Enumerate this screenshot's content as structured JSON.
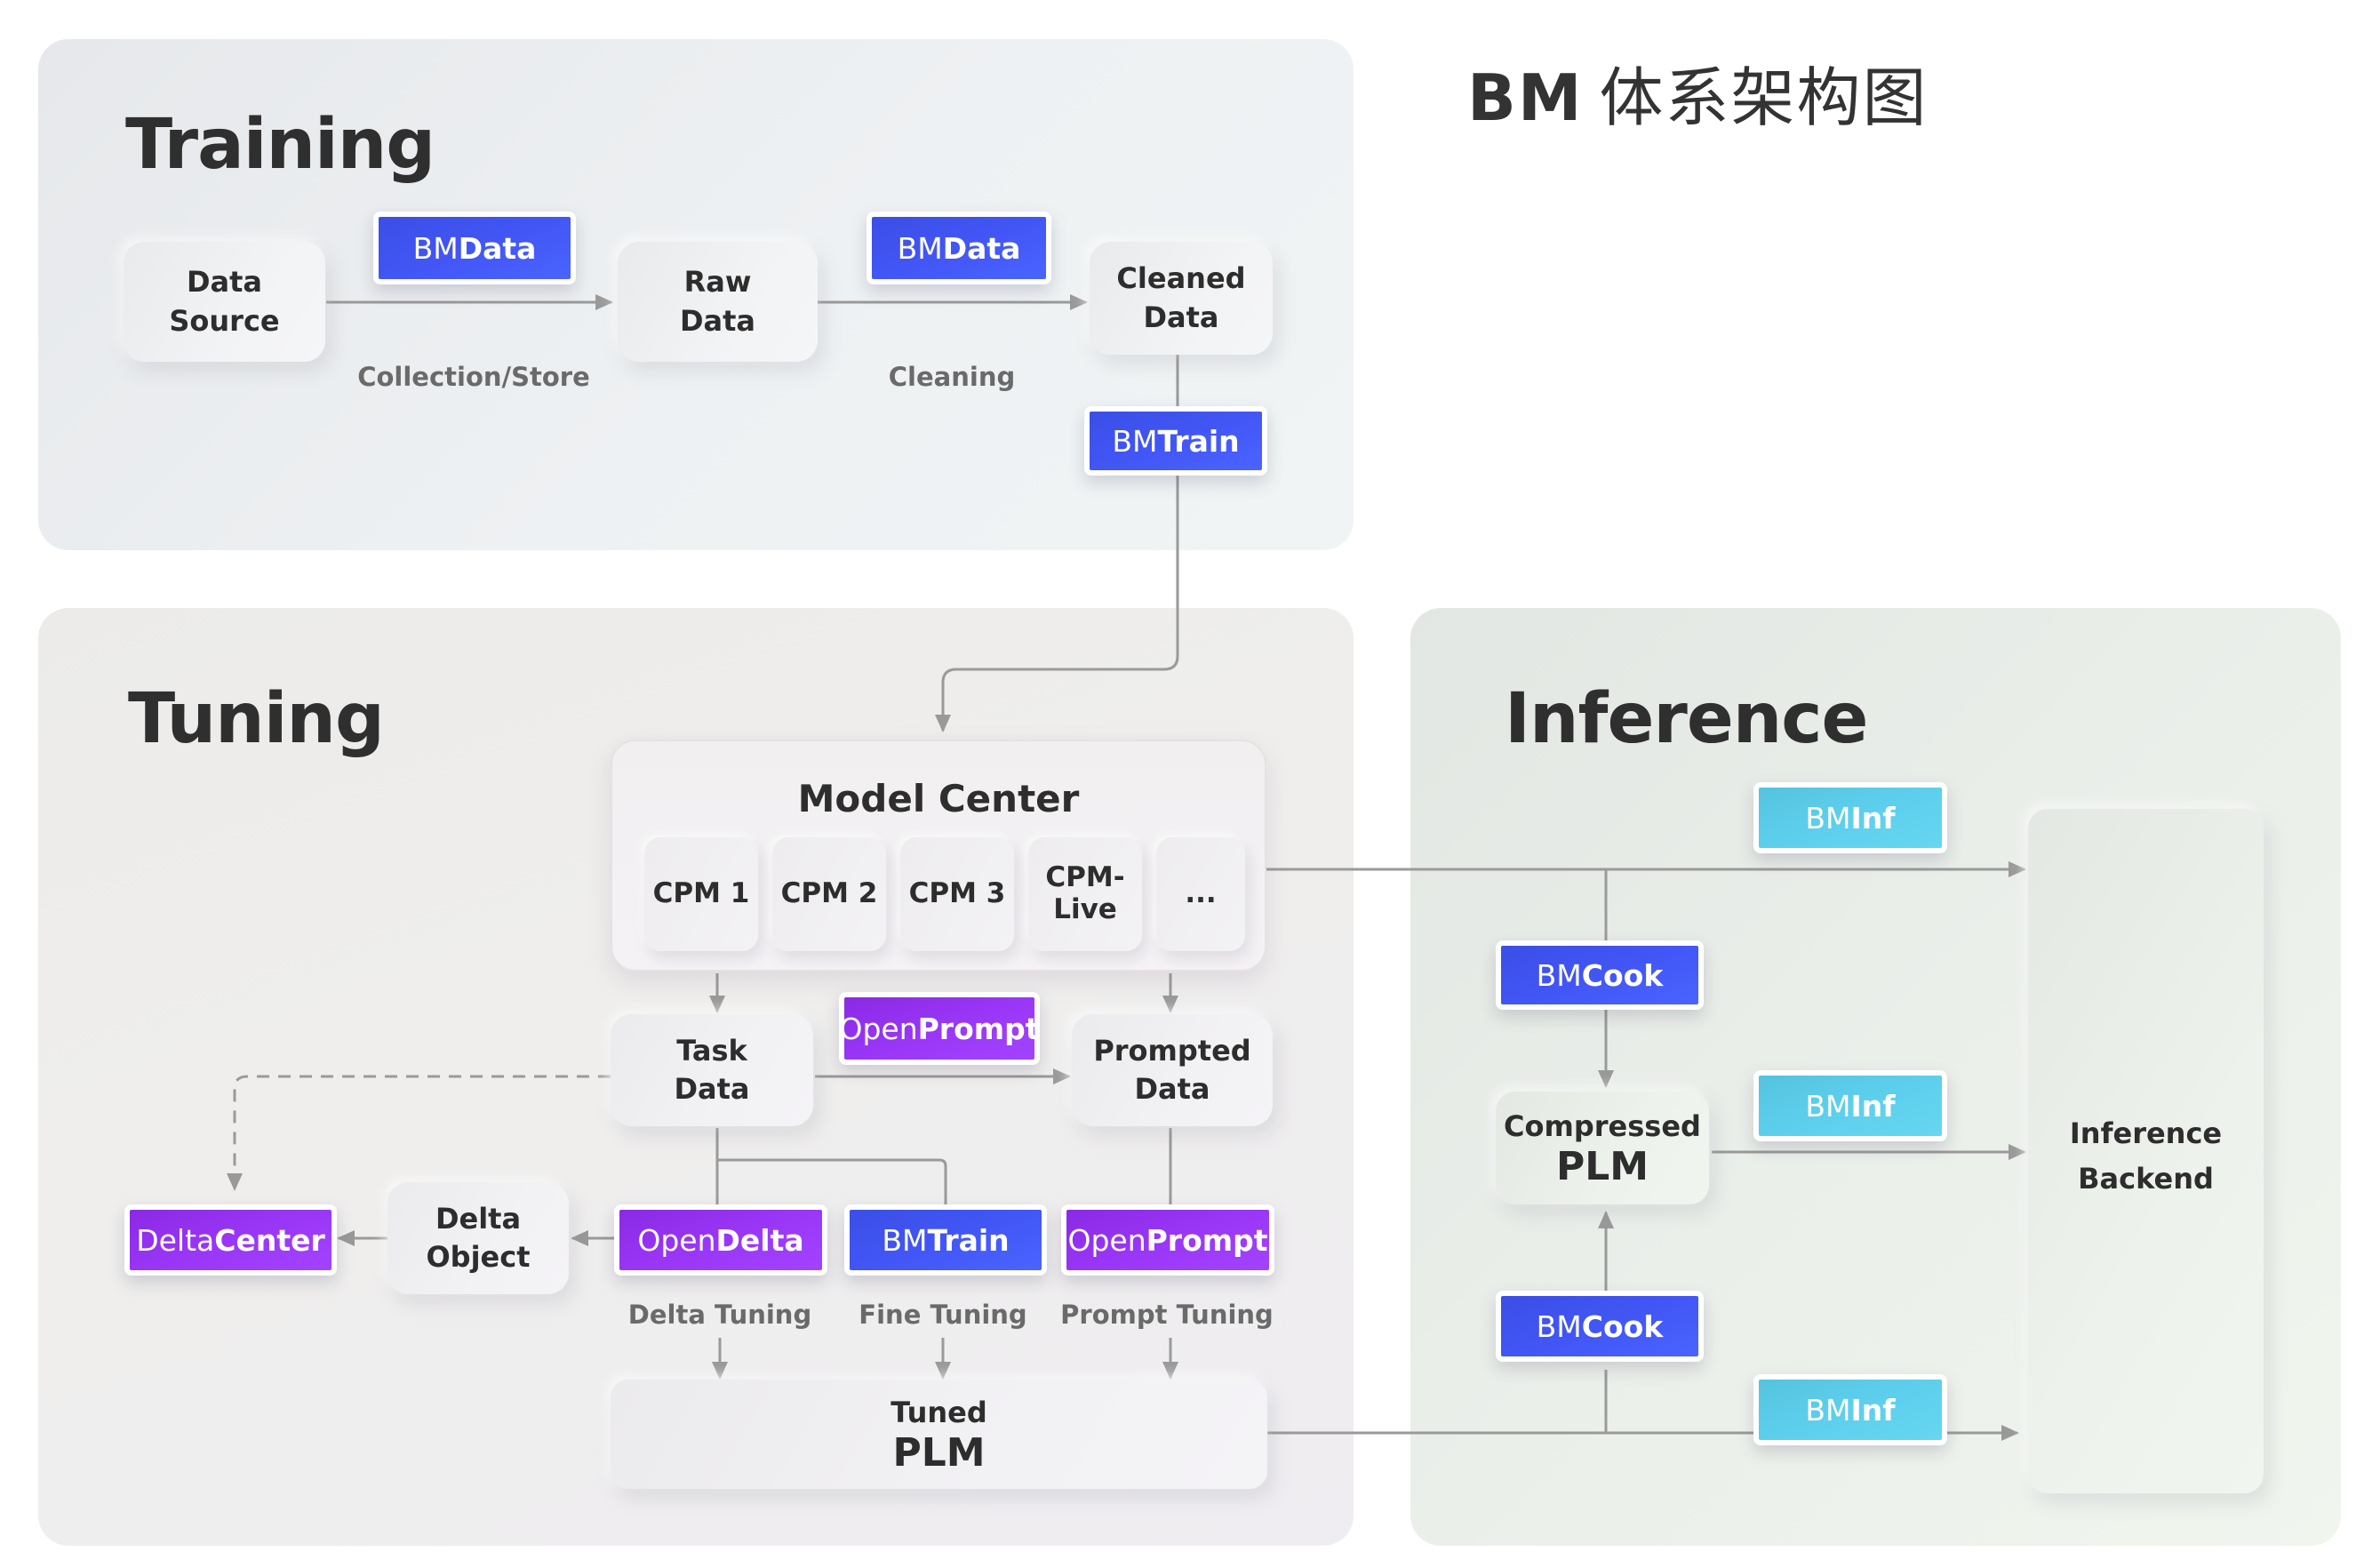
{
  "title": {
    "prefix": "BM",
    "suffix": "体系架构图"
  },
  "colors": {
    "bm_blue": "#4256f5",
    "open_purple": "#9a36f6",
    "bminf_cyan": "#5dcfec",
    "connector_gray": "#999999",
    "text_dark": "#2e2e2e",
    "label_gray": "#6a6a6a"
  },
  "training": {
    "title": "Training",
    "nodes": {
      "data_source": [
        "Data",
        "Source"
      ],
      "raw_data": [
        "Raw",
        "Data"
      ],
      "cleaned_data": [
        "Cleaned",
        "Data"
      ]
    },
    "tools": {
      "bmdata_1": {
        "light": "BM",
        "bold": "Data"
      },
      "bmdata_2": {
        "light": "BM",
        "bold": "Data"
      },
      "bmtrain": {
        "light": "BM",
        "bold": "Train"
      }
    },
    "edge_labels": {
      "collection": "Collection/Store",
      "cleaning": "Cleaning"
    }
  },
  "tuning": {
    "title": "Tuning",
    "model_center": {
      "title": "Model Center",
      "models": [
        "CPM 1",
        "CPM 2",
        "CPM 3",
        "CPM-\nLive",
        "..."
      ]
    },
    "nodes": {
      "task_data": [
        "Task",
        "Data"
      ],
      "prompted_data": [
        "Prompted",
        "Data"
      ],
      "delta_object": [
        "Delta",
        "Object"
      ],
      "tuned_plm": [
        "Tuned",
        "PLM"
      ]
    },
    "tools": {
      "openprompt_1": {
        "light": "Open",
        "bold": "Prompt"
      },
      "deltacenter": {
        "light": "Delta",
        "bold": "Center"
      },
      "opendelta": {
        "light": "Open",
        "bold": "Delta"
      },
      "bmtrain": {
        "light": "BM",
        "bold": "Train"
      },
      "openprompt_2": {
        "light": "Open",
        "bold": "Prompt"
      }
    },
    "edge_labels": {
      "delta_tuning": "Delta Tuning",
      "fine_tuning": "Fine Tuning",
      "prompt_tuning": "Prompt Tuning"
    }
  },
  "inference": {
    "title": "Inference",
    "nodes": {
      "compressed_plm": [
        "Compressed",
        "PLM"
      ],
      "inference_backend": [
        "Inference",
        "Backend"
      ]
    },
    "tools": {
      "bminf_1": {
        "light": "BM",
        "bold": "Inf"
      },
      "bmcook_1": {
        "light": "BM",
        "bold": "Cook"
      },
      "bminf_2": {
        "light": "BM",
        "bold": "Inf"
      },
      "bmcook_2": {
        "light": "BM",
        "bold": "Cook"
      },
      "bminf_3": {
        "light": "BM",
        "bold": "Inf"
      }
    }
  }
}
